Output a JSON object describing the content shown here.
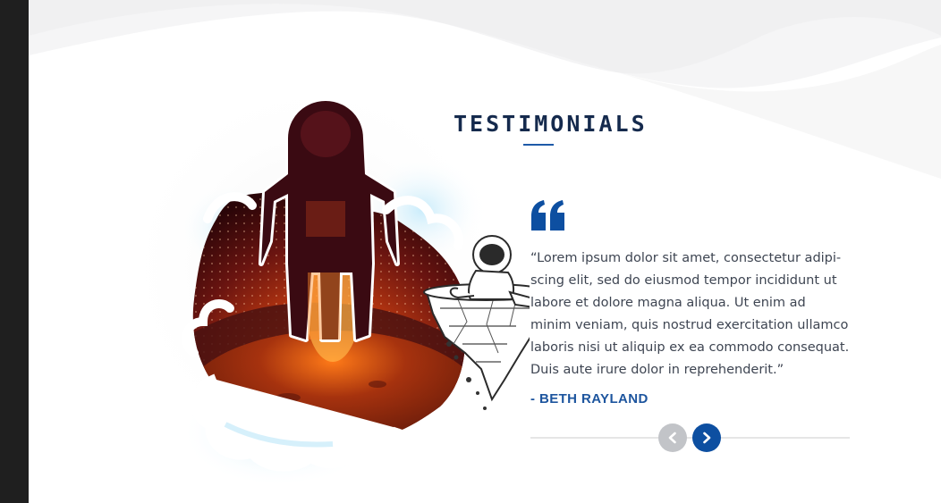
{
  "section": {
    "title": "TESTIMONIALS"
  },
  "testimonial": {
    "quote_lines": [
      "“Lorem ipsum dolor sit amet, consectetur adipi-",
      "scing elit, sed do eiusmod tempor incididunt ut",
      "labore et dolore magna aliqua. Ut enim ad",
      "minim veniam, quis nostrud exercitation ullamco",
      "laboris nisi ut aliquip ex ea commodo consequat.",
      "Duis aute irure dolor in reprehenderit.”"
    ],
    "author": "- BETH RAYLAND"
  },
  "navigation": {
    "prev_icon": "chevron-left-icon",
    "next_icon": "chevron-right-icon"
  },
  "colors": {
    "accent": "#0d4fa1",
    "title": "#152a4d",
    "text": "#3e4552",
    "sidebar": "#1f1f1f",
    "nav_inactive": "#c2c4c8"
  }
}
